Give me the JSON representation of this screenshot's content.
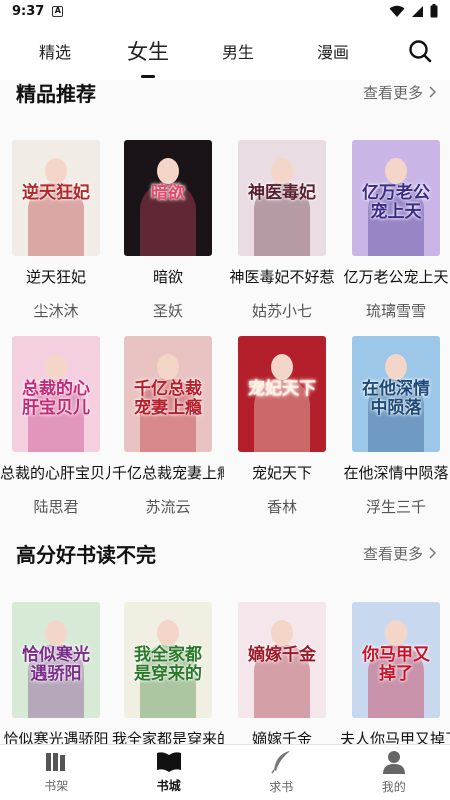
{
  "status_bar": {
    "time": "9:37",
    "badge": "A"
  },
  "top_nav": {
    "tabs": [
      {
        "label": "精选",
        "active": false
      },
      {
        "label": "女生",
        "active": true
      },
      {
        "label": "男生",
        "active": false
      },
      {
        "label": "漫画",
        "active": false
      }
    ]
  },
  "sections": [
    {
      "title": "精品推荐",
      "more": "查看更多",
      "books": [
        {
          "title": "逆天狂妃",
          "author": "尘沐沐",
          "cover_text": "逆天狂妃",
          "cover_bg": "#f2ece6",
          "cover_fg": "#b0282a"
        },
        {
          "title": "暗欲",
          "author": "圣妖",
          "cover_text": "暗欲",
          "cover_bg": "#1a1418",
          "cover_fg": "#e64a6a"
        },
        {
          "title": "神医毒妃不好惹",
          "author": "姑苏小七",
          "cover_text": "神医毒妃",
          "cover_bg": "#e9dde3",
          "cover_fg": "#5a2030"
        },
        {
          "title": "亿万老公宠上天",
          "author": "琉璃雪雪",
          "cover_text": "亿万老公宠上天",
          "cover_bg": "#c9b6e6",
          "cover_fg": "#3a2a8a"
        },
        {
          "title": "总裁的心肝宝贝儿",
          "author": "陆思君",
          "cover_text": "总裁的心肝宝贝儿",
          "cover_bg": "#f3cfe0",
          "cover_fg": "#c22a76"
        },
        {
          "title": "千亿总裁宠妻上瘾",
          "author": "苏流云",
          "cover_text": "千亿总裁宠妻上瘾",
          "cover_bg": "#e8c3c1",
          "cover_fg": "#b81e2a"
        },
        {
          "title": "宠妃天下",
          "author": "香林",
          "cover_text": "宠妃天下",
          "cover_bg": "#b3202b",
          "cover_fg": "#fff2e0"
        },
        {
          "title": "在他深情中陨落",
          "author": "浮生三千",
          "cover_text": "在他深情中陨落",
          "cover_bg": "#9cc7e8",
          "cover_fg": "#1c4a7a"
        }
      ]
    },
    {
      "title": "高分好书读不完",
      "more": "查看更多",
      "books": [
        {
          "title": "恰似寒光遇骄阳",
          "author": "",
          "cover_text": "恰似寒光遇骄阳",
          "cover_bg": "#d6ead6",
          "cover_fg": "#7a2e8a"
        },
        {
          "title": "我全家都是穿来的",
          "author": "",
          "cover_text": "我全家都是穿来的",
          "cover_bg": "#f1efe2",
          "cover_fg": "#2a7a2a"
        },
        {
          "title": "嫡嫁千金",
          "author": "",
          "cover_text": "嫡嫁千金",
          "cover_bg": "#f4e6ea",
          "cover_fg": "#9a1a2a"
        },
        {
          "title": "夫人你马甲又掉了",
          "author": "",
          "cover_text": "你马甲又掉了",
          "cover_bg": "#c8d8ee",
          "cover_fg": "#c8142a"
        }
      ]
    }
  ],
  "tab_bar": [
    {
      "label": "书架",
      "icon": "bookshelf-icon",
      "active": false
    },
    {
      "label": "书城",
      "icon": "open-book-icon",
      "active": true
    },
    {
      "label": "求书",
      "icon": "feather-icon",
      "active": false
    },
    {
      "label": "我的",
      "icon": "profile-icon",
      "active": false
    }
  ]
}
